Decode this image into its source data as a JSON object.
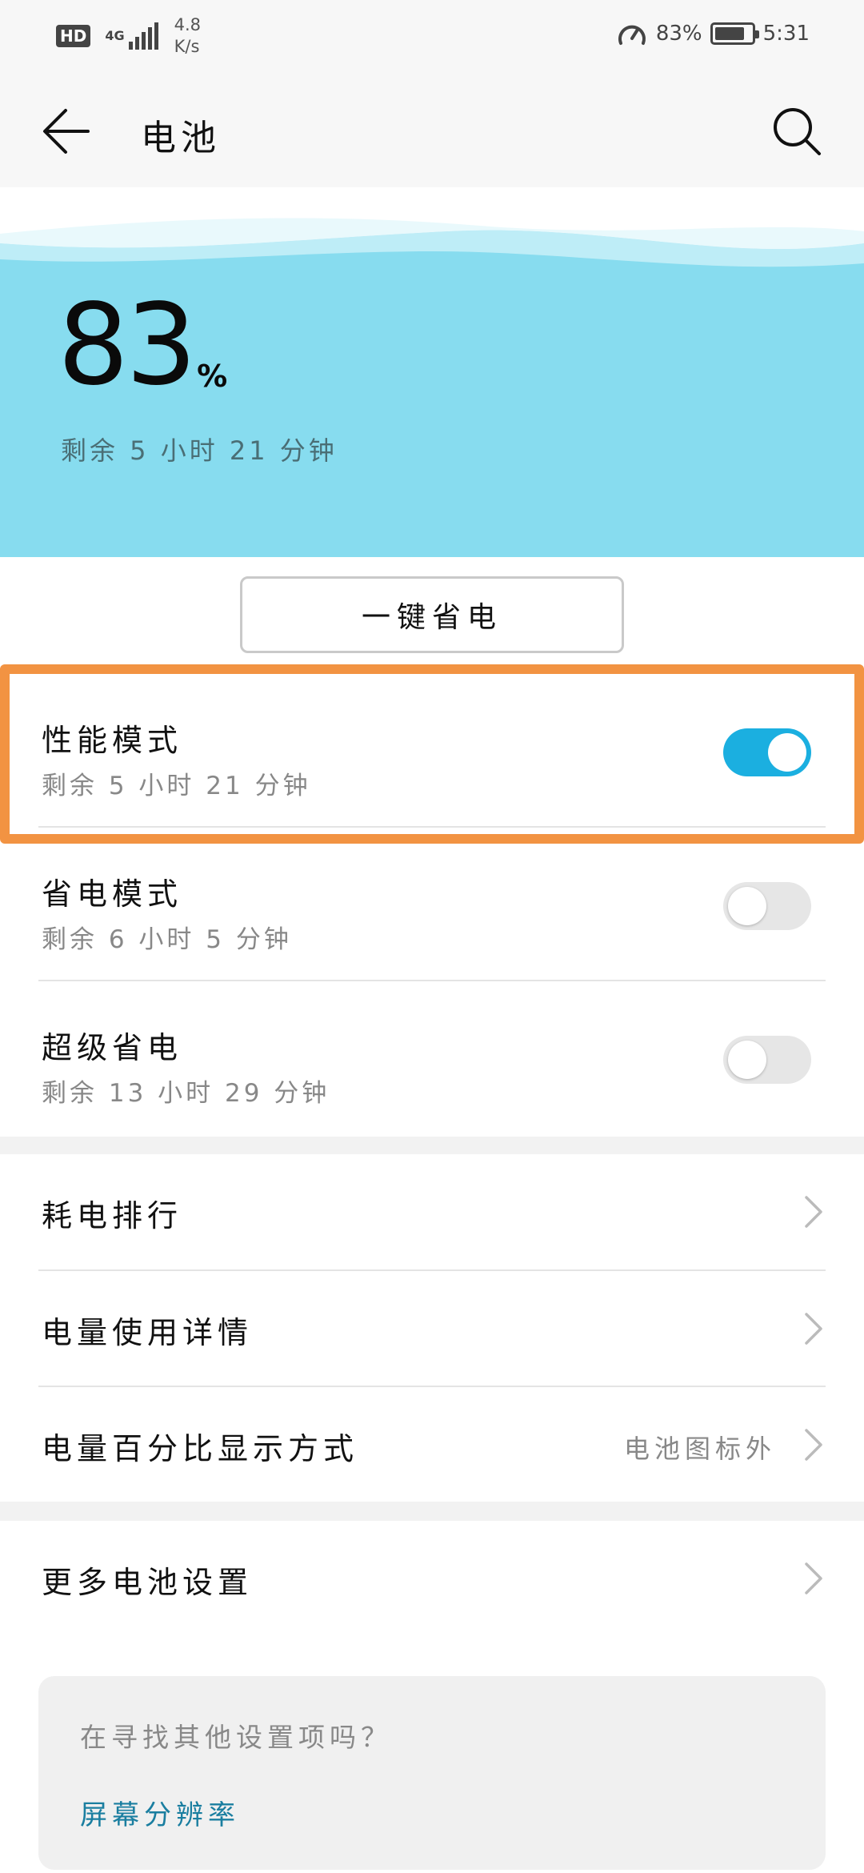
{
  "status_bar": {
    "hd": "HD",
    "network": "4G",
    "speed_value": "4.8",
    "speed_unit": "K/s",
    "battery_percent": "83%",
    "battery_level": 0.83,
    "time": "5:31"
  },
  "header": {
    "title": "电池",
    "back_icon": "arrow-left-icon",
    "search_icon": "search-icon"
  },
  "hero": {
    "percent": "83",
    "percent_sign": "%",
    "remaining": "剩余 5 小时 21 分钟",
    "color": "#87dcef"
  },
  "save_button": {
    "label": "一键省电"
  },
  "modes": [
    {
      "title": "性能模式",
      "subtitle": "剩余 5 小时 21 分钟",
      "on": true
    },
    {
      "title": "省电模式",
      "subtitle": "剩余 6 小时 5 分钟",
      "on": false
    },
    {
      "title": "超级省电",
      "subtitle": "剩余 13 小时 29 分钟",
      "on": false
    }
  ],
  "nav": [
    {
      "label": "耗电排行",
      "value": ""
    },
    {
      "label": "电量使用详情",
      "value": ""
    },
    {
      "label": "电量百分比显示方式",
      "value": "电池图标外"
    },
    {
      "label": "更多电池设置",
      "value": ""
    }
  ],
  "suggest": {
    "question": "在寻找其他设置项吗？",
    "link": "屏幕分辨率"
  },
  "colors": {
    "accent": "#1bafe0",
    "highlight": "#f29342",
    "link": "#1a7ea0"
  }
}
